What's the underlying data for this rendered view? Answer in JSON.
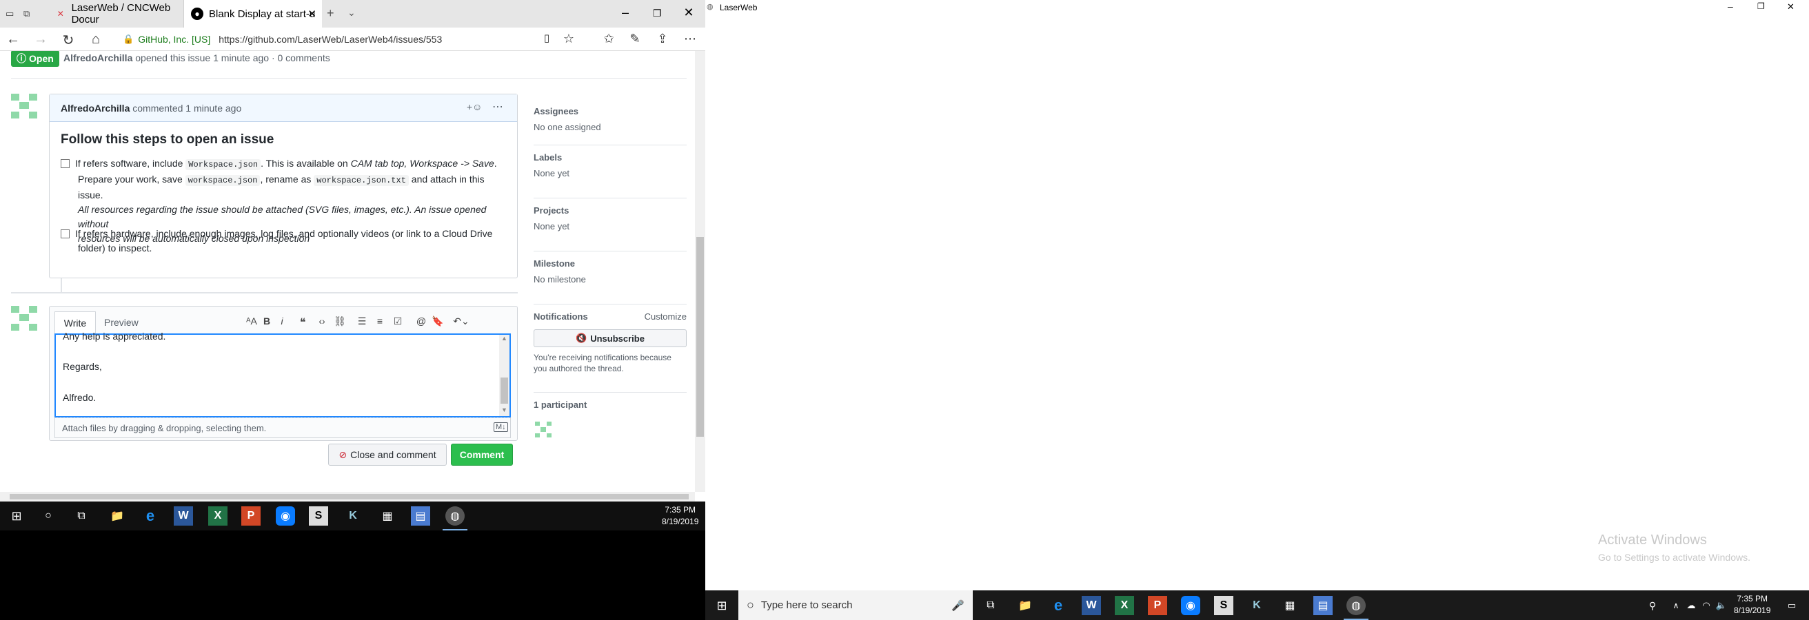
{
  "browser": {
    "tabs": [
      {
        "label": "LaserWeb / CNCWeb Docur",
        "icon": "laserweb-icon"
      },
      {
        "label": "Blank Display at start-u",
        "icon": "github-icon"
      }
    ],
    "cert": "GitHub, Inc. [US]",
    "url": "https://github.com/LaserWeb/LaserWeb4/issues/553"
  },
  "issue": {
    "status": "Open",
    "author": "AlfredoArchilla",
    "meta": "opened this issue 1 minute ago · 0 comments"
  },
  "comment": {
    "author": "AlfredoArchilla",
    "time": "commented 1 minute ago",
    "heading": "Follow this steps to open an issue",
    "task1": {
      "a": "If refers software, include ",
      "code1": "Workspace.json",
      "b": ". This is available on ",
      "em1": "CAM tab top, Workspace -> Save",
      "c": ".",
      "d": "Prepare your work, save ",
      "code2": "workspace.json",
      "e": ", rename as ",
      "code3": "workspace.json.txt",
      "f": " and attach in this issue.",
      "em2": "All resources regarding the issue should be attached (SVG files, images, etc.). An issue opened without",
      "em3": "resources will be automatically closed upon inspection"
    },
    "task2": {
      "line1": "If refers hardware, include enough images, log files, and optionally videos (or link to a Cloud Drive",
      "line2": "folder) to inspect."
    }
  },
  "editor": {
    "write": "Write",
    "preview": "Preview",
    "lines": [
      "Any help is appreciated.",
      "Regards,",
      "Alfredo."
    ],
    "attach": "Attach files by dragging & dropping, selecting them.",
    "close_btn": "Close and comment",
    "comment_btn": "Comment"
  },
  "sidebar": {
    "assignees": {
      "title": "Assignees",
      "value": "No one assigned"
    },
    "labels": {
      "title": "Labels",
      "value": "None yet"
    },
    "projects": {
      "title": "Projects",
      "value": "None yet"
    },
    "milestone": {
      "title": "Milestone",
      "value": "No milestone"
    },
    "notifications": {
      "title": "Notifications",
      "customize": "Customize",
      "unsubscribe": "Unsubscribe",
      "reason1": "You're receiving notifications because",
      "reason2": "you authored the thread."
    },
    "participants": "1 participant"
  },
  "taskbar_left": {
    "time": "7:35 PM",
    "date": "8/19/2019"
  },
  "right_window": {
    "title": "LaserWeb"
  },
  "watermark": {
    "line1": "Activate Windows",
    "line2": "Go to Settings to activate Windows."
  },
  "taskbar_right": {
    "search": "Type here to search",
    "time": "7:35 PM",
    "date": "8/19/2019"
  },
  "colors": {
    "accent": "#2188ff",
    "green": "#2cbe4e",
    "open": "#28a745"
  }
}
